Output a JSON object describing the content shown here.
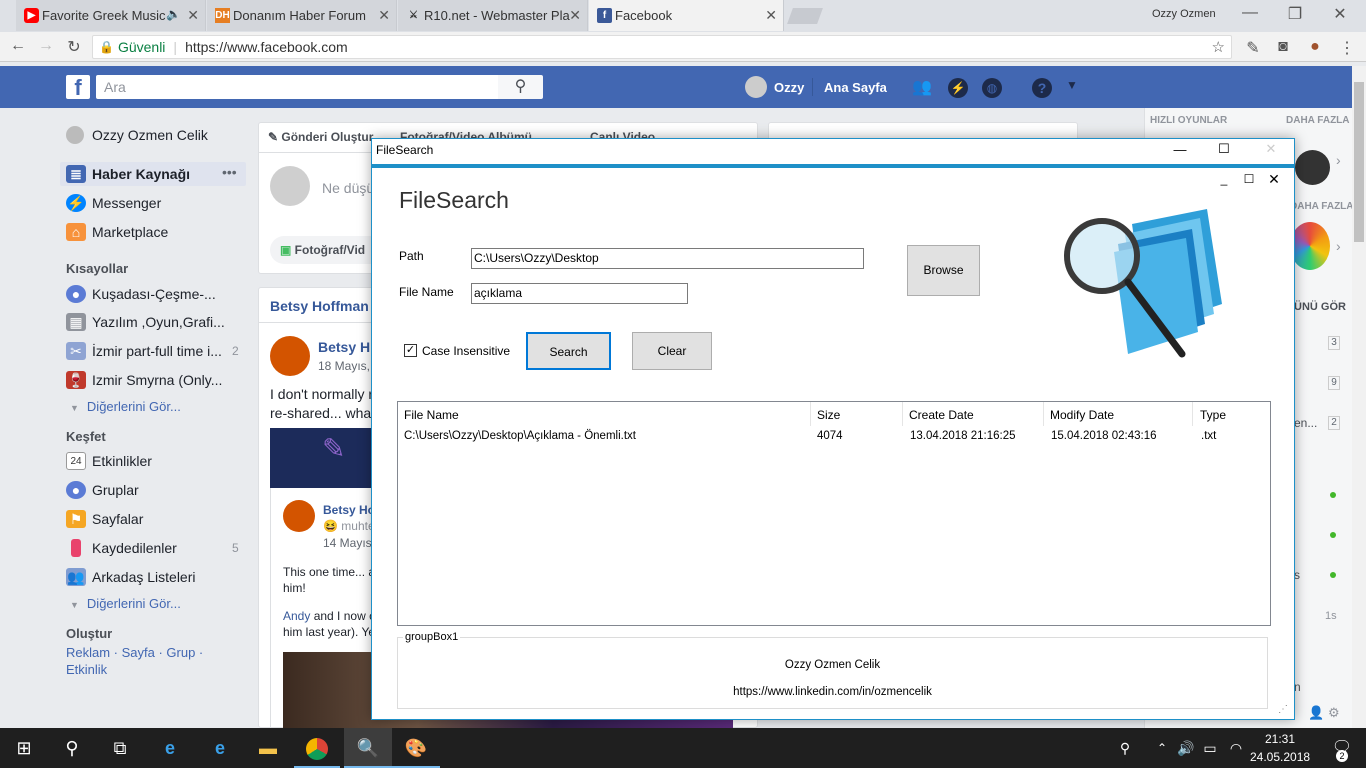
{
  "browser": {
    "tabs": [
      {
        "title": "Favorite Greek Music",
        "color": "#ff0000"
      },
      {
        "title": "Donanım Haber Forum",
        "color": "#e67e22"
      },
      {
        "title": "R10.net - Webmaster Pla",
        "color": "#333333"
      },
      {
        "title": "Facebook",
        "color": "#3b5998"
      }
    ],
    "user": "Ozzy Ozmen",
    "secure_label": "Güvenli",
    "url": "https://www.facebook.com"
  },
  "facebook": {
    "search_placeholder": "Ara",
    "profile_name": "Ozzy",
    "home": "Ana Sayfa",
    "sidebar": {
      "user": "Ozzy Ozmen Celik",
      "main": [
        {
          "label": "Haber Kaynağı"
        },
        {
          "label": "Messenger"
        },
        {
          "label": "Marketplace"
        }
      ],
      "shortcuts_title": "Kısayollar",
      "shortcuts": [
        {
          "label": "Kuşadası-Çeşme-...",
          "count": ""
        },
        {
          "label": "Yazılım ,Oyun,Grafi...",
          "count": ""
        },
        {
          "label": "İzmir part-full time i...",
          "count": "2"
        },
        {
          "label": "Izmir Smyrna (Only...",
          "count": ""
        }
      ],
      "see_more": "Diğerlerini Gör...",
      "explore_title": "Keşfet",
      "explore": [
        {
          "label": "Etkinlikler",
          "count": ""
        },
        {
          "label": "Gruplar",
          "count": ""
        },
        {
          "label": "Sayfalar",
          "count": ""
        },
        {
          "label": "Kaydedilenler",
          "count": "5"
        },
        {
          "label": "Arkadaş Listeleri",
          "count": ""
        }
      ],
      "create_title": "Oluştur",
      "create_links": "Reklam · Sayfa · Grup ·",
      "create_links2": "Etkinlik"
    },
    "composer": {
      "tab1": "Gönderi Oluştur",
      "tab2": "Fotoğraf/Video Albümü",
      "tab3": "Canlı Video",
      "placeholder": "Ne düşü",
      "photo": "Fotoğraf/Vid"
    },
    "post": {
      "shared_by": "Betsy Hoffman W",
      "author": "Betsy H",
      "date": "18 Mayıs,",
      "text1": "I don't normally r",
      "text2": "re-shared... wha",
      "inner_author": "Betsy Ho",
      "inner_feeling": "muhte",
      "inner_date": "14 Mayıs",
      "inner_text1": "This one time... a",
      "inner_text2": "him!",
      "inner_text3a": "Andy",
      "inner_text3b": " and I now c",
      "inner_text4": "him last year). Ye"
    },
    "right": {
      "games": "HIZLI OYUNLAR",
      "more": "DAHA FAZLA",
      "more2": "DAHA FAZLA",
      "see_all": "ÜNÜ GÖR",
      "counts": [
        "3",
        "9",
        "2"
      ],
      "partial": "en...",
      "partial2": "s",
      "time": "1s",
      "partial3": "n"
    }
  },
  "app": {
    "window_title": "FileSearch",
    "heading": "FileSearch",
    "path_label": "Path",
    "path_value": "C:\\Users\\Ozzy\\Desktop",
    "filename_label": "File Name",
    "filename_value": "açıklama",
    "browse": "Browse",
    "case_label": "Case Insensitive",
    "search": "Search",
    "clear": "Clear",
    "columns": [
      "File Name",
      "Size",
      "Create Date",
      "Modify Date",
      "Type"
    ],
    "rows": [
      {
        "name": "C:\\Users\\Ozzy\\Desktop\\Açıklama - Önemli.txt",
        "size": "4074",
        "created": "13.04.2018 21:16:25",
        "modified": "15.04.2018 02:43:16",
        "type": ".txt"
      }
    ],
    "groupbox_title": "groupBox1",
    "author": "Ozzy Ozmen Celik",
    "link": "https://www.linkedin.com/in/ozmencelik"
  },
  "taskbar": {
    "time": "21:31",
    "date": "24.05.2018",
    "notif": "2"
  }
}
